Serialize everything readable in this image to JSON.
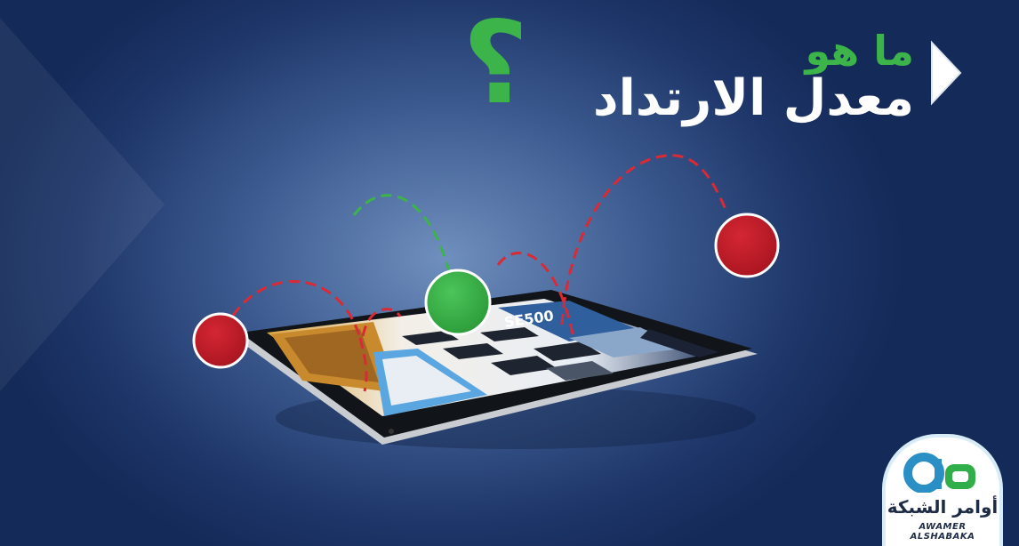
{
  "headline": {
    "line1": "ما هو",
    "line2": "معدل الارتداد",
    "question_mark": "؟"
  },
  "tablet_screen": {
    "banner_text": "SE500"
  },
  "logo": {
    "name_ar": "أوامر الشبكة",
    "name_en": "AWAMER ALSHABAKA"
  },
  "colors": {
    "background_dark": "#142a58",
    "background_glow": "#6f8fbe",
    "accent_green": "#3cb44a",
    "bounce_red": "#c01e2c",
    "title_white": "#ffffff"
  },
  "icons": {
    "play_arrow": "play-arrow-icon",
    "logo_mark": "logo-mark-icon"
  }
}
